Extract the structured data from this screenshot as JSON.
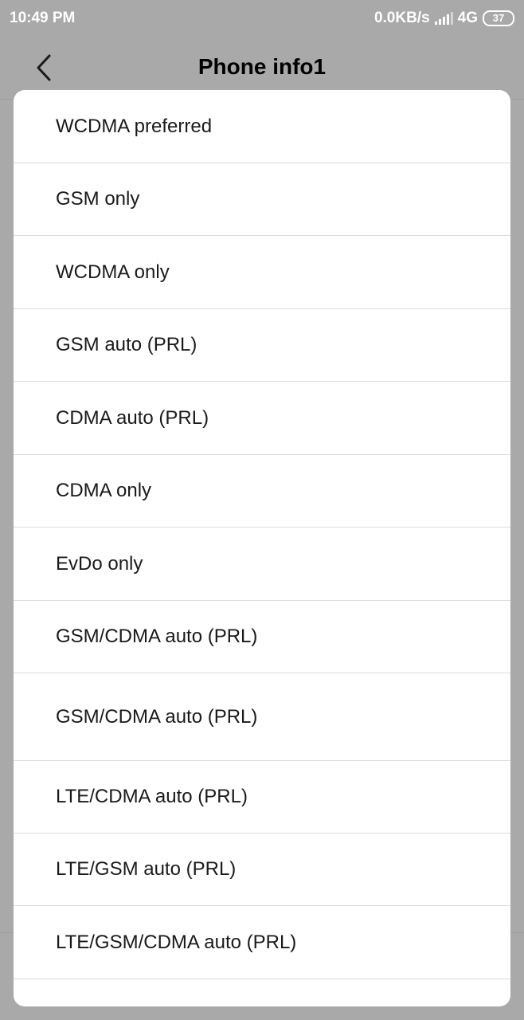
{
  "status_bar": {
    "time": "10:49 PM",
    "network_speed": "0.0KB/s",
    "network_type": "4G",
    "battery": "37"
  },
  "header": {
    "title": "Phone info1",
    "back_icon": "chevron-left-icon"
  },
  "dialog": {
    "options": [
      {
        "label": "WCDMA preferred"
      },
      {
        "label": "GSM only"
      },
      {
        "label": "WCDMA only"
      },
      {
        "label": "GSM auto (PRL)"
      },
      {
        "label": "CDMA auto (PRL)"
      },
      {
        "label": "CDMA only"
      },
      {
        "label": "EvDo only"
      },
      {
        "label": "GSM/CDMA auto (PRL)"
      },
      {
        "label": "GSM/CDMA auto (PRL)"
      },
      {
        "label": "LTE/CDMA auto (PRL)"
      },
      {
        "label": "LTE/GSM auto (PRL)"
      },
      {
        "label": "LTE/GSM/CDMA auto (PRL)"
      },
      {
        "label": ""
      }
    ]
  },
  "colors": {
    "scrim": "#a9a9a9",
    "dialog_bg": "#ffffff",
    "divider": "#dcdcdc",
    "text": "#1a1a1a"
  }
}
